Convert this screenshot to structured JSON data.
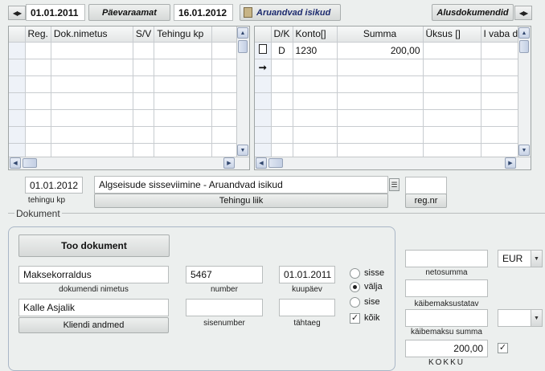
{
  "toolbar": {
    "date_start": "01.01.2011",
    "journal_button": "Päevaraamat",
    "date_end": "16.01.2012",
    "report_button": "Aruandvad isikud",
    "base_docs_button": "Alusdokumendid"
  },
  "left_grid": {
    "columns": [
      "Reg.",
      "Dok.nimetus",
      "S/V",
      "Tehingu kp"
    ]
  },
  "right_grid": {
    "columns": [
      "D/K",
      "Konto[]",
      "Summa",
      "Üksus []",
      "I vaba di"
    ],
    "rows": [
      {
        "dk": "D",
        "konto": "1230",
        "summa": "200,00"
      }
    ]
  },
  "transaction": {
    "date": "01.01.2012",
    "date_caption": "tehingu kp",
    "type_value": "Algseisude sisseviimine - Aruandvad isikud",
    "type_button": "Tehingu liik",
    "regnr_value": "",
    "regnr_caption": "reg.nr"
  },
  "document": {
    "section_title": "Dokument",
    "fetch_button": "Too dokument",
    "name_value": "Maksekorraldus",
    "name_caption": "dokumendi nimetus",
    "number_value": "5467",
    "number_caption": "number",
    "date_value": "01.01.2011",
    "date_caption": "kuupäev",
    "client_value": "Kalle Asjalik",
    "client_button": "Kliendi andmed",
    "internal_number_value": "",
    "internal_number_caption": "sisenumber",
    "due_value": "",
    "due_caption": "tähtaeg",
    "direction_options": [
      "sisse",
      "välja",
      "sise"
    ],
    "direction_selected": "välja",
    "all_label": "kõik",
    "all_checked": true
  },
  "totals": {
    "net_value": "",
    "net_caption": "netosumma",
    "vat_rate_value": "",
    "vat_rate_caption": "käibemaksustatav",
    "vat_sum_value": "",
    "vat_sum_caption": "käibemaksu summa",
    "total_value": "200,00",
    "total_caption": "KOKKU",
    "currency": "EUR",
    "vat_select_value": ""
  }
}
